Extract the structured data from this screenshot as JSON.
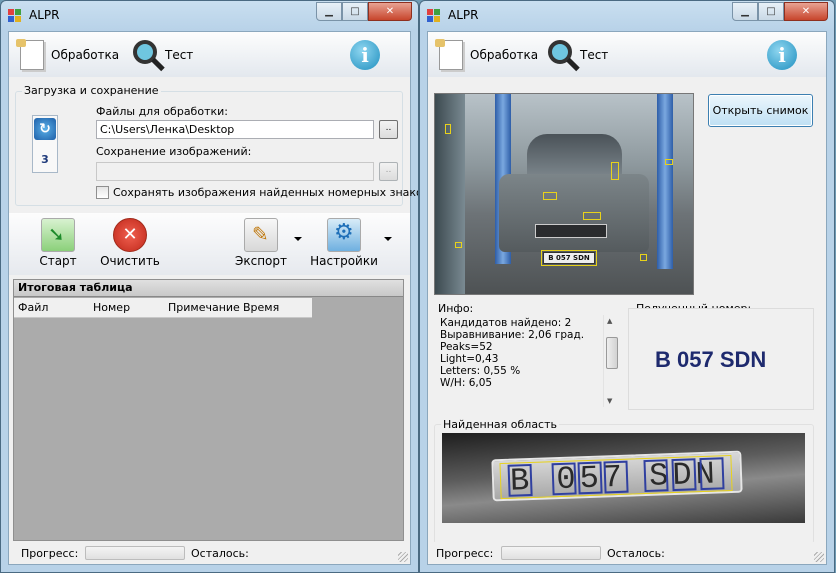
{
  "left": {
    "title": "ALPR",
    "tabs": {
      "process": "Обработка",
      "test": "Тест"
    },
    "load_save": {
      "group_title": "Загрузка и сохранение",
      "counter": "3",
      "files_label": "Файлы для обработки:",
      "files_value": "C:\\Users\\Ленка\\Desktop",
      "browse": "..",
      "save_label": "Сохранение изображений:",
      "save_value": "",
      "save_checkbox": "Сохранять изображения найденных номерных знаков"
    },
    "toolbar": {
      "start": "Старт",
      "clear": "Очистить",
      "export": "Экспорт",
      "settings": "Настройки"
    },
    "table": {
      "title": "Итоговая таблица",
      "columns": [
        "Файл",
        "Номер",
        "Примечание",
        "Время"
      ]
    },
    "status": {
      "progress": "Прогресс:",
      "remaining": "Осталось:",
      "progress_value": 0
    }
  },
  "right": {
    "title": "ALPR",
    "tabs": {
      "process": "Обработка",
      "test": "Тест"
    },
    "open_button": "Открыть снимок",
    "info": {
      "title": "Инфо:",
      "lines": [
        "Кандидатов найдено: 2",
        "Выравнивание: 2,06 град.",
        "Peaks=52",
        "Light=0,43",
        "Letters: 0,55 %",
        "W/H: 6,05"
      ]
    },
    "result": {
      "title": "Полученный номер:",
      "plate": "B 057 SDN"
    },
    "found_area": {
      "title": "Найденная область",
      "plate_text": "B 057 SDN",
      "photo_plate": "B 057 SDN"
    },
    "status": {
      "progress": "Прогресс:",
      "remaining": "Осталось:",
      "progress_value": 0
    }
  },
  "colors": {
    "accent": "#1e2a6e",
    "titlebar": "#c9dff0",
    "detection": "#e8d21a"
  }
}
